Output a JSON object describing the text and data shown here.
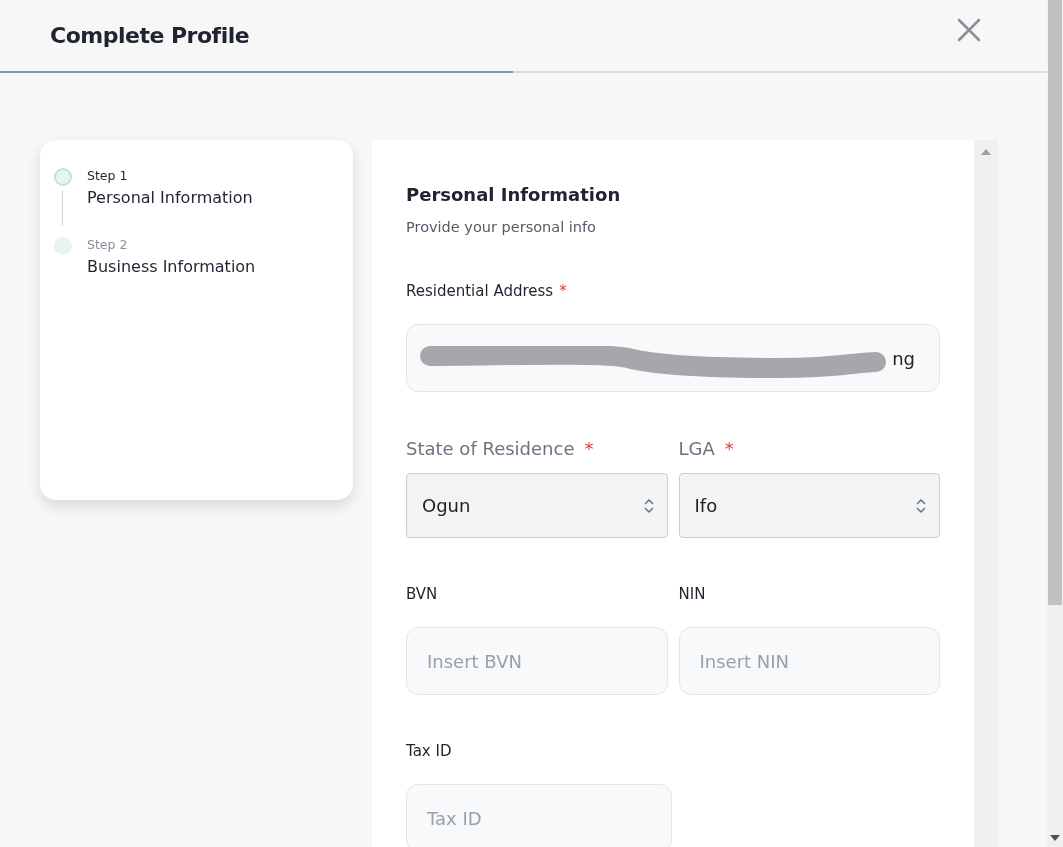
{
  "header": {
    "title": "Complete Profile",
    "progress": {
      "level": 0.49
    }
  },
  "steps": [
    {
      "step": "Step 1",
      "label": "Personal Information",
      "selected": true
    },
    {
      "step": "Step 2",
      "label": "Business Information",
      "selected": false
    }
  ],
  "form": {
    "title": "Personal Information",
    "subtitle": "Provide your personal info",
    "rows": [
      [
        {
          "kind": "text",
          "label": "Residential Address",
          "required_mark": "*",
          "value": "ng",
          "redacted": true
        }
      ],
      [
        {
          "kind": "select",
          "label": "State of Residence",
          "required_mark": "*",
          "value": "Ogun"
        },
        {
          "kind": "select",
          "label": "LGA",
          "required_mark": "*",
          "value": "Ifo"
        }
      ],
      [
        {
          "kind": "text",
          "label": "BVN",
          "placeholder": "Insert BVN"
        },
        {
          "kind": "text",
          "label": "NIN",
          "placeholder": "Insert NIN"
        }
      ],
      [
        {
          "kind": "text",
          "label": "Tax ID",
          "placeholder": "Tax ID"
        }
      ]
    ]
  }
}
